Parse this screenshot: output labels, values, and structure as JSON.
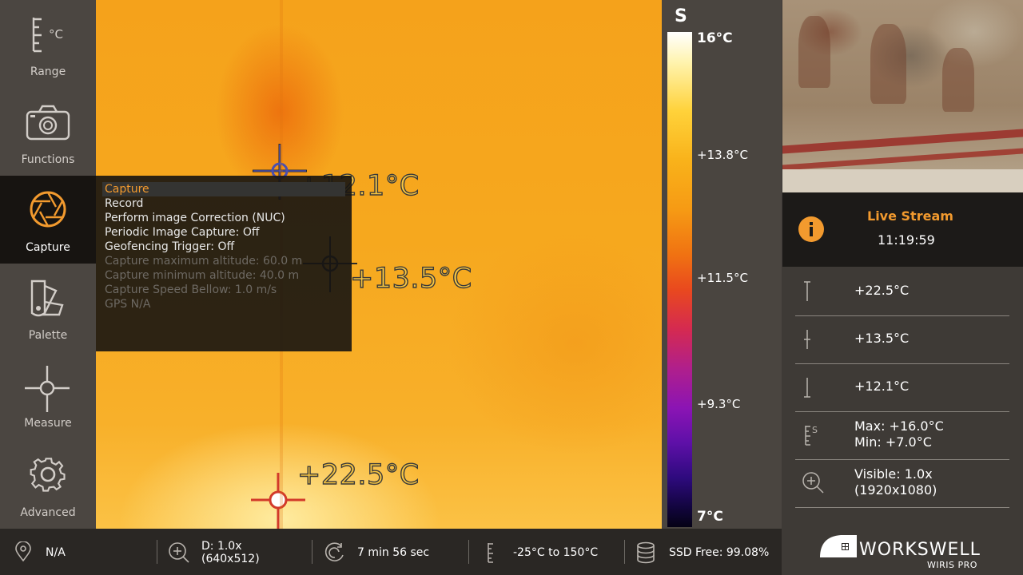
{
  "sidebar": {
    "items": [
      {
        "label": "Range",
        "icon": "range-celsius-icon"
      },
      {
        "label": "Functions",
        "icon": "camera-icon"
      },
      {
        "label": "Capture",
        "icon": "aperture-icon",
        "active": true
      },
      {
        "label": "Palette",
        "icon": "palette-swatch-icon"
      },
      {
        "label": "Measure",
        "icon": "crosshair-icon"
      },
      {
        "label": "Advanced",
        "icon": "gear-icon"
      }
    ],
    "range_unit": "°C"
  },
  "thermal_view": {
    "markers": [
      {
        "label": "+12.1°C",
        "kind": "min",
        "color": "#4a4fb0"
      },
      {
        "label": "+13.5°C",
        "kind": "center",
        "color": "#2a2a2a"
      },
      {
        "label": "+22.5°C",
        "kind": "max",
        "color": "#d23a2a"
      }
    ]
  },
  "capture_menu": {
    "items": [
      {
        "label": "Capture",
        "state": "selected"
      },
      {
        "label": "Record",
        "state": "enabled"
      },
      {
        "label": "Perform image Correction (NUC)",
        "state": "enabled"
      },
      {
        "label": "Periodic Image Capture: Off",
        "state": "enabled"
      },
      {
        "label": "Geofencing Trigger: Off",
        "state": "enabled"
      },
      {
        "label": "Capture maximum altitude: 60.0 m",
        "state": "disabled"
      },
      {
        "label": "Capture minimum altitude: 40.0 m",
        "state": "disabled"
      },
      {
        "label": "Capture Speed Bellow: 1.0 m/s",
        "state": "disabled"
      },
      {
        "label": "GPS N/A",
        "state": "disabled"
      }
    ],
    "accent_color": "#f29a2e"
  },
  "color_scale": {
    "mode": "S",
    "top": "16°C",
    "ticks": [
      "+13.8°C",
      "+11.5°C",
      "+9.3°C"
    ],
    "bottom": "7°C"
  },
  "live": {
    "title": "Live Stream",
    "time": "11:19:59"
  },
  "readings": {
    "max": "+22.5°C",
    "center": "+13.5°C",
    "min": "+12.1°C",
    "range_max": "Max: +16.0°C",
    "range_min": "Min: +7.0°C",
    "range_mode": "S",
    "visible_zoom": "Visible: 1.0x",
    "visible_res": "(1920x1080)"
  },
  "bottom_bar": {
    "gps": "N/A",
    "zoom": "D: 1.0x",
    "resolution": "(640x512)",
    "timer": "7 min 56 sec",
    "range": "-25°C to 150°C",
    "storage": "SSD Free: 99.08%"
  },
  "brand": {
    "name": "WORKSWELL",
    "product": "WIRIS PRO"
  }
}
